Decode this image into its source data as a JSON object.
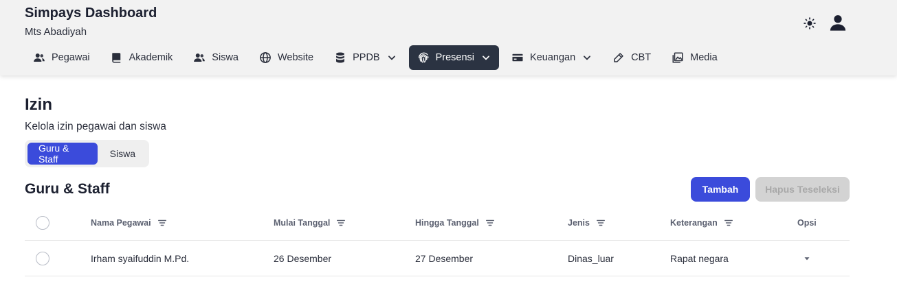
{
  "app": {
    "title": "Simpays Dashboard",
    "subtitle": "Mts Abadiyah"
  },
  "header_icons": {
    "theme_toggle": "sun-icon",
    "user_menu": "user-icon"
  },
  "nav": {
    "items": [
      {
        "label": "Pegawai",
        "icon": "users-icon"
      },
      {
        "label": "Akademik",
        "icon": "book-icon"
      },
      {
        "label": "Siswa",
        "icon": "users-icon"
      },
      {
        "label": "Website",
        "icon": "globe-icon"
      },
      {
        "label": "PPDB",
        "icon": "database-icon",
        "has_dropdown": true
      },
      {
        "label": "Presensi",
        "icon": "fingerprint-icon",
        "has_dropdown": true,
        "active": true
      },
      {
        "label": "Keuangan",
        "icon": "credit-card-icon",
        "has_dropdown": true
      },
      {
        "label": "CBT",
        "icon": "pencil-icon"
      },
      {
        "label": "Media",
        "icon": "images-icon"
      }
    ]
  },
  "page": {
    "title": "Izin",
    "description": "Kelola izin pegawai dan siswa"
  },
  "tabs": [
    {
      "label": "Guru & Staff",
      "active": true
    },
    {
      "label": "Siswa",
      "active": false
    }
  ],
  "section": {
    "title": "Guru & Staff",
    "add_label": "Tambah",
    "delete_selected_label": "Hapus Teseleksi"
  },
  "table": {
    "columns": [
      "Nama Pegawai",
      "Mulai Tanggal",
      "Hingga Tanggal",
      "Jenis",
      "Keterangan",
      "Opsi"
    ],
    "rows": [
      [
        "Irham syaifuddin M.Pd.",
        "26 Desember",
        "27 Desember",
        "Dinas_luar",
        "Rapat negara"
      ]
    ]
  },
  "colors": {
    "primary": "#3b4bdb",
    "nav_active": "#2b3342",
    "header_bg": "#f2f2f2",
    "disabled_bg": "#d3d3d3"
  }
}
